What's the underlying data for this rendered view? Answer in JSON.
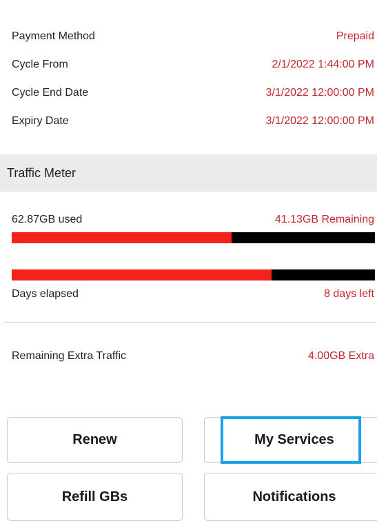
{
  "details": [
    {
      "label": "Payment Method",
      "value": "Prepaid"
    },
    {
      "label": "Cycle From",
      "value": "2/1/2022 1:44:00 PM"
    },
    {
      "label": "Cycle End Date",
      "value": "3/1/2022 12:00:00 PM"
    },
    {
      "label": "Expiry Date",
      "value": "3/1/2022 12:00:00 PM"
    }
  ],
  "traffic_meter": {
    "title": "Traffic Meter",
    "used_label": "62.87GB used",
    "remaining_label": "41.13GB Remaining",
    "usage_fraction": 0.605,
    "days_fraction": 0.715,
    "days_label": "Days elapsed",
    "days_left_label": "8 days left"
  },
  "extra": {
    "label": "Remaining Extra Traffic",
    "value": "4.00GB Extra"
  },
  "buttons": {
    "renew": "Renew",
    "my_services": "My Services",
    "refill": "Refill GBs",
    "notifications": "Notifications"
  },
  "colors": {
    "accent_red": "#c4262e",
    "bar_fill": "#f5221b",
    "highlight": "#1aa3e8"
  }
}
